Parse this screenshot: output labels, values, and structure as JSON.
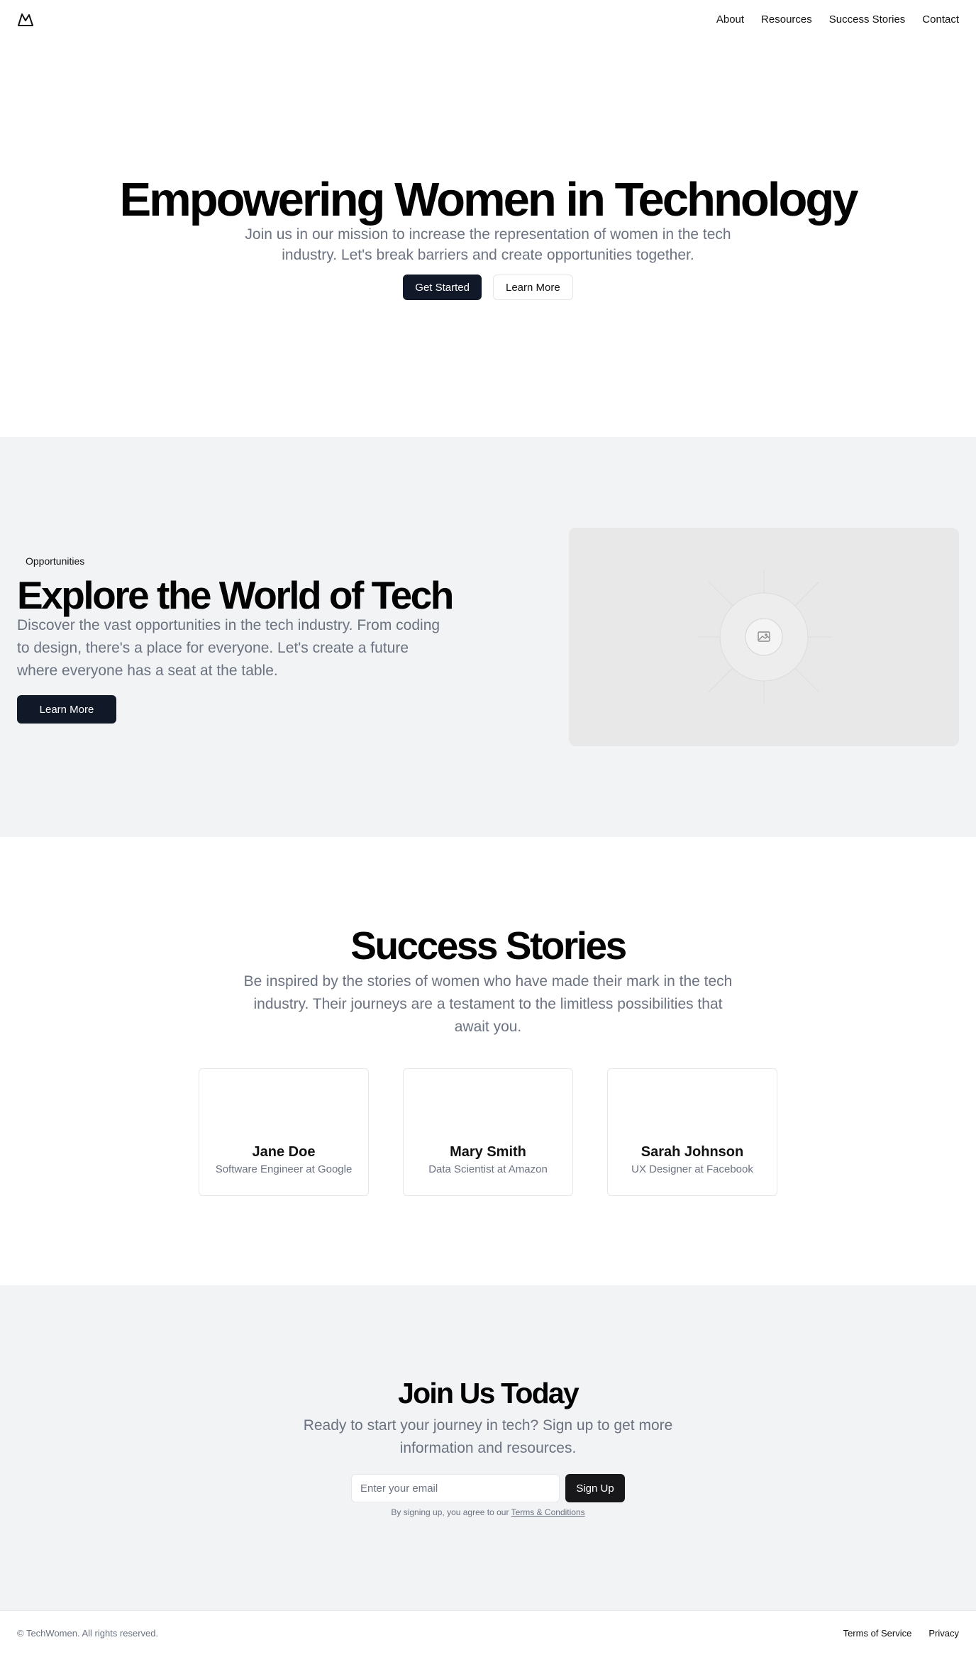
{
  "header": {
    "logo_icon": "mountain-icon",
    "nav": [
      "About",
      "Resources",
      "Success Stories",
      "Contact"
    ]
  },
  "hero": {
    "title": "Empowering Women in Technology",
    "subtitle": "Join us in our mission to increase the representation of women in the tech industry. Let's break barriers and create opportunities together.",
    "primary_button": "Get Started",
    "secondary_button": "Learn More"
  },
  "explore": {
    "badge": "Opportunities",
    "title": "Explore the World of Tech",
    "description": "Discover the vast opportunities in the tech industry. From coding to design, there's a place for everyone. Let's create a future where everyone has a seat at the table.",
    "button": "Learn More",
    "image_icon": "image-placeholder-icon"
  },
  "stories": {
    "title": "Success Stories",
    "subtitle": "Be inspired by the stories of women who have made their mark in the tech industry. Their journeys are a testament to the limitless possibilities that await you.",
    "people": [
      {
        "name": "Jane Doe",
        "role": "Software Engineer at Google"
      },
      {
        "name": "Mary Smith",
        "role": "Data Scientist at Amazon"
      },
      {
        "name": "Sarah Johnson",
        "role": "UX Designer at Facebook"
      }
    ]
  },
  "join": {
    "title": "Join Us Today",
    "subtitle": "Ready to start your journey in tech? Sign up to get more information and resources.",
    "email_placeholder": "Enter your email",
    "button": "Sign Up",
    "terms_prefix": "By signing up, you agree to our ",
    "terms_link": "Terms & Conditions"
  },
  "footer": {
    "copyright": "© TechWomen. All rights reserved.",
    "links": [
      "Terms of Service",
      "Privacy"
    ]
  },
  "colors": {
    "primary": "#111827",
    "muted_text": "#6b7280",
    "section_bg": "#f2f3f5",
    "border": "#e5e7eb"
  }
}
